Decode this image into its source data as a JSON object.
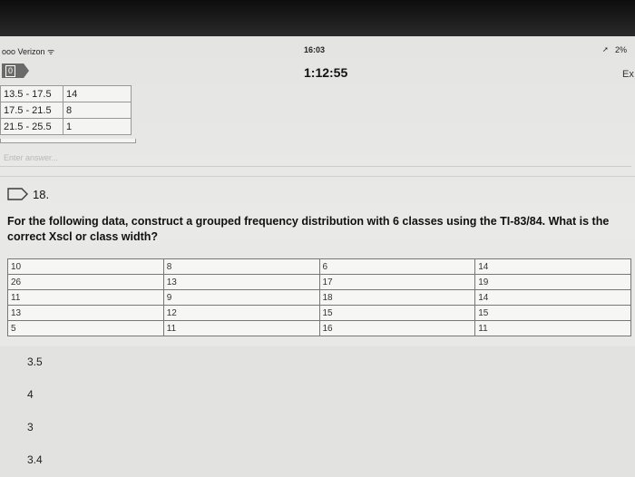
{
  "status": {
    "carrier": "ooo Verizon ᯤ",
    "time": "16:03",
    "battery": "2%",
    "location_icon": "location-arrow-icon"
  },
  "header": {
    "badge": "0",
    "timer": "1:12:55",
    "exit_label": "Ex"
  },
  "previous_table": [
    {
      "interval": "13.5 - 17.5",
      "freq": "14"
    },
    {
      "interval": "17.5 - 21.5",
      "freq": "8"
    },
    {
      "interval": "21.5 - 25.5",
      "freq": "1"
    }
  ],
  "answer_input": {
    "placeholder": "Enter answer..."
  },
  "question": {
    "number": "18.",
    "text": "For the following data, construct a grouped frequency distribution with 6 classes using the TI-83/84. What is the correct Xscl or class width?",
    "data_rows": [
      [
        "10",
        "8",
        "6",
        "14"
      ],
      [
        "26",
        "13",
        "17",
        "19"
      ],
      [
        "11",
        "9",
        "18",
        "14"
      ],
      [
        "13",
        "12",
        "15",
        "15"
      ],
      [
        "5",
        "11",
        "16",
        "11"
      ]
    ],
    "options": [
      "3.5",
      "4",
      "3",
      "3.4"
    ]
  },
  "colors": {
    "screen_bg": "#e6e6e4",
    "option_bg": "#e2e2e0",
    "badge_bg": "#6a6a6a"
  }
}
